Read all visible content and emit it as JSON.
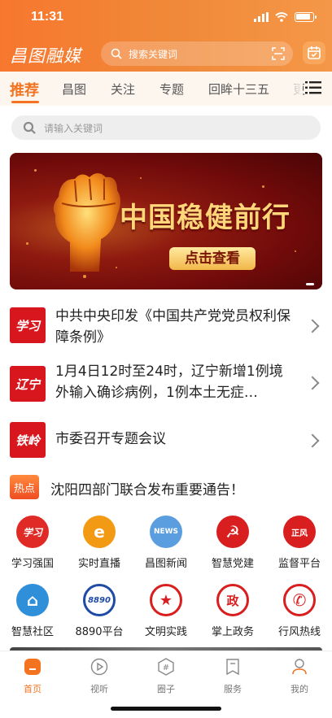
{
  "status_bar": {
    "time": "11:31"
  },
  "header": {
    "logo": "昌图融媒",
    "search_placeholder": "搜索关键词",
    "scan_icon": "scan-icon",
    "calendar_icon": "calendar-icon"
  },
  "tabs": [
    "推荐",
    "昌图",
    "关注",
    "专题",
    "回眸十三五",
    "更"
  ],
  "active_tab": "推荐",
  "search_box": {
    "placeholder": "请输入关键词"
  },
  "banner": {
    "title": "中国稳健前行",
    "cta": "点击查看"
  },
  "news": [
    {
      "badge": "学习",
      "title": "中共中央印发《中国共产党党员权利保障条例》"
    },
    {
      "badge": "辽宁",
      "title": "1月4日12时至24时，辽宁新增1例境外输入确诊病例，1例本土无症…"
    },
    {
      "badge": "铁岭",
      "title": "市委召开专题会议"
    }
  ],
  "hot": {
    "badge": "热点",
    "title": "沈阳四部门联合发布重要通告！"
  },
  "services": [
    {
      "label": "学习强国",
      "icon": "xuexi-icon",
      "mark": "学习",
      "color": "#e02a25"
    },
    {
      "label": "实时直播",
      "icon": "live-icon",
      "mark": "e",
      "color": "#f39a14"
    },
    {
      "label": "昌图新闻",
      "icon": "news-globe-icon",
      "mark": "NEWS",
      "color": "#5a9ee0"
    },
    {
      "label": "智慧党建",
      "icon": "party-icon",
      "mark": "☭",
      "color": "#d81e1e"
    },
    {
      "label": "监督平台",
      "icon": "supervision-icon",
      "mark": "正风",
      "color": "#d81e1e"
    },
    {
      "label": "智慧社区",
      "icon": "community-icon",
      "mark": "⌂",
      "color": "#2f8fd8"
    },
    {
      "label": "8890平台",
      "icon": "platform-8890-icon",
      "mark": "8890",
      "color": "#1f4aa6"
    },
    {
      "label": "文明实践",
      "icon": "civilization-icon",
      "mark": "★",
      "color": "#d81e1e"
    },
    {
      "label": "掌上政务",
      "icon": "government-icon",
      "mark": "政",
      "color": "#d81e1e"
    },
    {
      "label": "行风热线",
      "icon": "hotline-icon",
      "mark": "✆",
      "color": "#d81e1e"
    }
  ],
  "tabbar": [
    {
      "label": "首页",
      "icon": "home-icon"
    },
    {
      "label": "视听",
      "icon": "play-icon"
    },
    {
      "label": "圈子",
      "icon": "circle-icon"
    },
    {
      "label": "服务",
      "icon": "service-icon"
    },
    {
      "label": "我的",
      "icon": "profile-icon"
    }
  ],
  "colors": {
    "accent": "#f47320",
    "header_start": "#f7772e",
    "header_end": "#f59748",
    "badge_red": "#d7161d"
  }
}
